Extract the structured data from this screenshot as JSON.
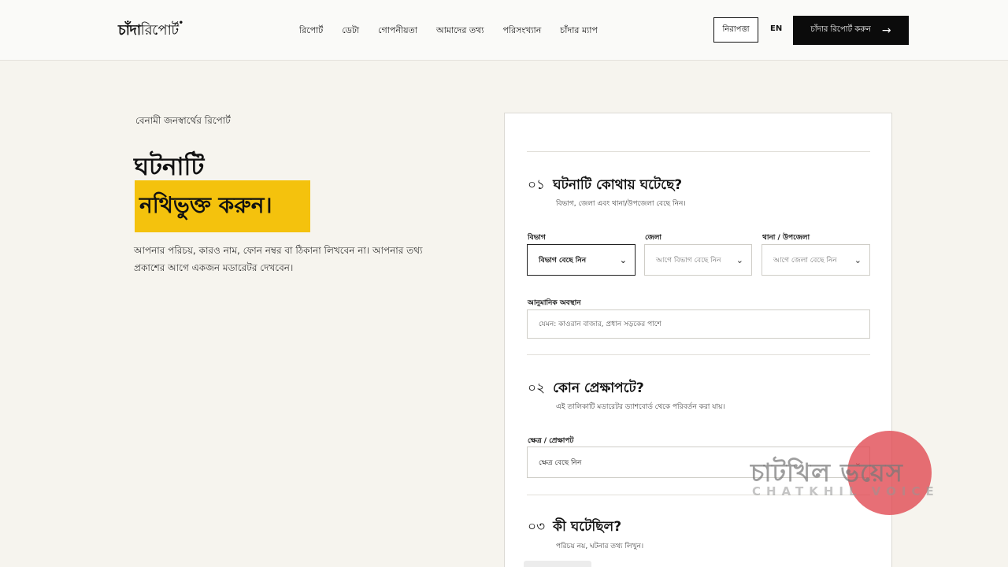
{
  "header": {
    "logo_bold": "চাঁদা",
    "logo_light": "রিপোর্ট",
    "logo_dot": "•",
    "nav": [
      "রিপোর্ট",
      "ডেটা",
      "গোপনীয়তা",
      "আমাদের তথ্য",
      "পরিসংখ্যান",
      "চাঁদার ম্যাপ"
    ],
    "safety_label": "নিরাপত্তা",
    "lang_label": "EN",
    "report_button_label": "চাঁদার রিপোর্ট করুন",
    "report_button_arrow": "→"
  },
  "intro": {
    "eyebrow": "বেনামী জনস্বার্থের রিপোর্ট",
    "title_line1": "ঘটনাটি",
    "title_line2": "নথিভুক্ত করুন।",
    "description": "আপনার পরিচয়, কারও নাম, ফোন নম্বর বা ঠিকানা লিখবেন না। আপনার তথ্য প্রকাশের আগে একজন মডারেটর দেখবেন।"
  },
  "form": {
    "section1": {
      "number": "০১",
      "title": "ঘটনাটি কোথায় ঘটেছে?",
      "help": "বিভাগ, জেলা এবং থানা/উপজেলা বেছে নিন।",
      "division_label": "বিভাগ",
      "division_value": "বিভাগ বেছে নিন",
      "district_label": "জেলা",
      "district_value": "আগে বিভাগ বেছে নিন",
      "thana_label": "থানা / উপজেলা",
      "thana_value": "আগে জেলা বেছে নিন",
      "location_label": "আনুমানিক অবস্থান",
      "location_placeholder": "যেমন: কাওরান বাজার, প্রধান সড়কের পাশে"
    },
    "section2": {
      "number": "০২",
      "title": "কোন প্রেক্ষাপটে?",
      "help": "এই তালিকাটি মডারেটর ড্যাশবোর্ড থেকে পরিবর্তন করা যায়।",
      "sector_label": "ক্ষেত্র / প্রেক্ষাপট",
      "sector_value": "ক্ষেত্র বেছে নিন"
    },
    "section3": {
      "number": "০৩",
      "title": "কী ঘটেছিল?",
      "help": "পরিচয় নয়, ঘটনার তথ্য লিখুন।"
    }
  },
  "watermark": {
    "text": "চাটখিল ভয়েস",
    "sub": "CHATKHIL VOICE"
  },
  "icons": {
    "chevron": "⌄"
  }
}
